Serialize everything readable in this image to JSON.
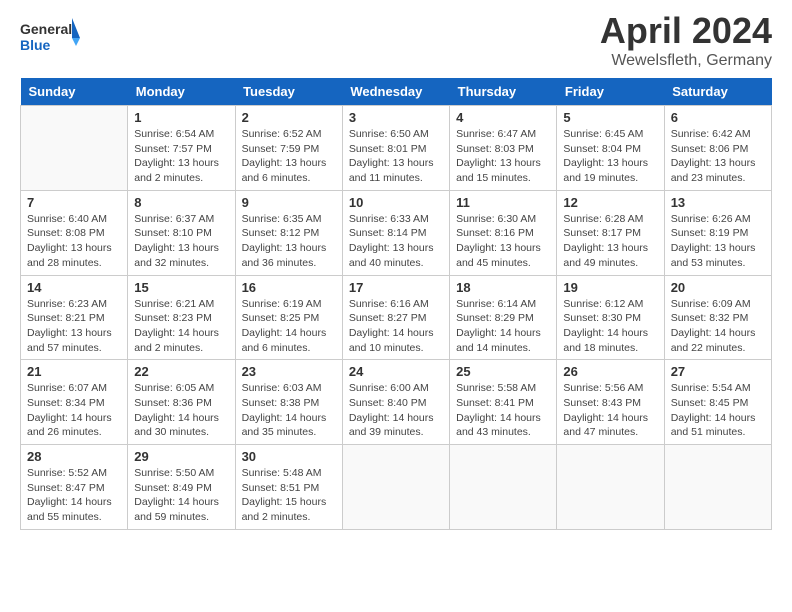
{
  "header": {
    "logo_general": "General",
    "logo_blue": "Blue",
    "title": "April 2024",
    "subtitle": "Wewelsfleth, Germany"
  },
  "days_of_week": [
    "Sunday",
    "Monday",
    "Tuesday",
    "Wednesday",
    "Thursday",
    "Friday",
    "Saturday"
  ],
  "weeks": [
    [
      {
        "day": "",
        "info": ""
      },
      {
        "day": "1",
        "info": "Sunrise: 6:54 AM\nSunset: 7:57 PM\nDaylight: 13 hours\nand 2 minutes."
      },
      {
        "day": "2",
        "info": "Sunrise: 6:52 AM\nSunset: 7:59 PM\nDaylight: 13 hours\nand 6 minutes."
      },
      {
        "day": "3",
        "info": "Sunrise: 6:50 AM\nSunset: 8:01 PM\nDaylight: 13 hours\nand 11 minutes."
      },
      {
        "day": "4",
        "info": "Sunrise: 6:47 AM\nSunset: 8:03 PM\nDaylight: 13 hours\nand 15 minutes."
      },
      {
        "day": "5",
        "info": "Sunrise: 6:45 AM\nSunset: 8:04 PM\nDaylight: 13 hours\nand 19 minutes."
      },
      {
        "day": "6",
        "info": "Sunrise: 6:42 AM\nSunset: 8:06 PM\nDaylight: 13 hours\nand 23 minutes."
      }
    ],
    [
      {
        "day": "7",
        "info": "Sunrise: 6:40 AM\nSunset: 8:08 PM\nDaylight: 13 hours\nand 28 minutes."
      },
      {
        "day": "8",
        "info": "Sunrise: 6:37 AM\nSunset: 8:10 PM\nDaylight: 13 hours\nand 32 minutes."
      },
      {
        "day": "9",
        "info": "Sunrise: 6:35 AM\nSunset: 8:12 PM\nDaylight: 13 hours\nand 36 minutes."
      },
      {
        "day": "10",
        "info": "Sunrise: 6:33 AM\nSunset: 8:14 PM\nDaylight: 13 hours\nand 40 minutes."
      },
      {
        "day": "11",
        "info": "Sunrise: 6:30 AM\nSunset: 8:16 PM\nDaylight: 13 hours\nand 45 minutes."
      },
      {
        "day": "12",
        "info": "Sunrise: 6:28 AM\nSunset: 8:17 PM\nDaylight: 13 hours\nand 49 minutes."
      },
      {
        "day": "13",
        "info": "Sunrise: 6:26 AM\nSunset: 8:19 PM\nDaylight: 13 hours\nand 53 minutes."
      }
    ],
    [
      {
        "day": "14",
        "info": "Sunrise: 6:23 AM\nSunset: 8:21 PM\nDaylight: 13 hours\nand 57 minutes."
      },
      {
        "day": "15",
        "info": "Sunrise: 6:21 AM\nSunset: 8:23 PM\nDaylight: 14 hours\nand 2 minutes."
      },
      {
        "day": "16",
        "info": "Sunrise: 6:19 AM\nSunset: 8:25 PM\nDaylight: 14 hours\nand 6 minutes."
      },
      {
        "day": "17",
        "info": "Sunrise: 6:16 AM\nSunset: 8:27 PM\nDaylight: 14 hours\nand 10 minutes."
      },
      {
        "day": "18",
        "info": "Sunrise: 6:14 AM\nSunset: 8:29 PM\nDaylight: 14 hours\nand 14 minutes."
      },
      {
        "day": "19",
        "info": "Sunrise: 6:12 AM\nSunset: 8:30 PM\nDaylight: 14 hours\nand 18 minutes."
      },
      {
        "day": "20",
        "info": "Sunrise: 6:09 AM\nSunset: 8:32 PM\nDaylight: 14 hours\nand 22 minutes."
      }
    ],
    [
      {
        "day": "21",
        "info": "Sunrise: 6:07 AM\nSunset: 8:34 PM\nDaylight: 14 hours\nand 26 minutes."
      },
      {
        "day": "22",
        "info": "Sunrise: 6:05 AM\nSunset: 8:36 PM\nDaylight: 14 hours\nand 30 minutes."
      },
      {
        "day": "23",
        "info": "Sunrise: 6:03 AM\nSunset: 8:38 PM\nDaylight: 14 hours\nand 35 minutes."
      },
      {
        "day": "24",
        "info": "Sunrise: 6:00 AM\nSunset: 8:40 PM\nDaylight: 14 hours\nand 39 minutes."
      },
      {
        "day": "25",
        "info": "Sunrise: 5:58 AM\nSunset: 8:41 PM\nDaylight: 14 hours\nand 43 minutes."
      },
      {
        "day": "26",
        "info": "Sunrise: 5:56 AM\nSunset: 8:43 PM\nDaylight: 14 hours\nand 47 minutes."
      },
      {
        "day": "27",
        "info": "Sunrise: 5:54 AM\nSunset: 8:45 PM\nDaylight: 14 hours\nand 51 minutes."
      }
    ],
    [
      {
        "day": "28",
        "info": "Sunrise: 5:52 AM\nSunset: 8:47 PM\nDaylight: 14 hours\nand 55 minutes."
      },
      {
        "day": "29",
        "info": "Sunrise: 5:50 AM\nSunset: 8:49 PM\nDaylight: 14 hours\nand 59 minutes."
      },
      {
        "day": "30",
        "info": "Sunrise: 5:48 AM\nSunset: 8:51 PM\nDaylight: 15 hours\nand 2 minutes."
      },
      {
        "day": "",
        "info": ""
      },
      {
        "day": "",
        "info": ""
      },
      {
        "day": "",
        "info": ""
      },
      {
        "day": "",
        "info": ""
      }
    ]
  ]
}
